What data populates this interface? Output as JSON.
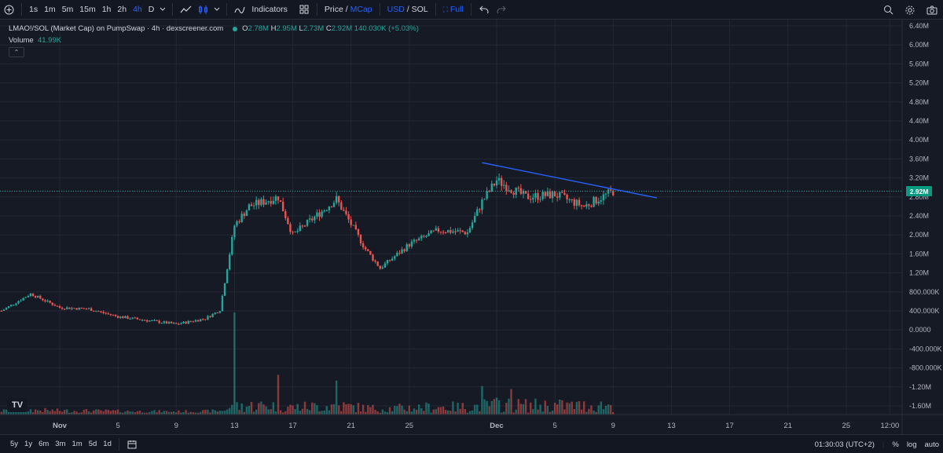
{
  "toolbar": {
    "add_symbol_icon": "plus-circle-icon",
    "intervals": [
      "1s",
      "1m",
      "5m",
      "15m",
      "1h",
      "2h",
      "4h",
      "D"
    ],
    "active_interval": "4h",
    "indicators_label": "Indicators",
    "price_label": "Price",
    "mcap_label": "MCap",
    "usd_label": "USD",
    "sol_label": "SOL",
    "full_label": "Full",
    "slash": "/",
    "accent": "#2962ff"
  },
  "legend": {
    "title": "LMAO!/SOL (Market Cap) on PumpSwap · 4h · dexscreener.com",
    "o_label": "O",
    "o": "2.78M",
    "h_label": "H",
    "h": "2.95M",
    "l_label": "L",
    "l": "2.73M",
    "c_label": "C",
    "c": "2.92M",
    "change": "140.030K (+5.03%)",
    "volume_label": "Volume",
    "volume_value": "41.99K"
  },
  "last_price_tag": "2.92M",
  "colors": {
    "up": "#26a69a",
    "down": "#ef5350",
    "trendline": "#2962ff",
    "background": "#161a25"
  },
  "logo_text": "TV",
  "bottom": {
    "ranges": [
      "5y",
      "1y",
      "6m",
      "3m",
      "1m",
      "5d",
      "1d"
    ],
    "time": "01:30:03 (UTC+2)",
    "percent": "%",
    "log": "log",
    "auto": "auto"
  },
  "chart_data": {
    "type": "candlestick",
    "title": "LMAO!/SOL (Market Cap) on PumpSwap · 4h · dexscreener.com",
    "y_ticks": [
      "6.40M",
      "6.00M",
      "5.60M",
      "5.20M",
      "4.80M",
      "4.40M",
      "4.00M",
      "3.60M",
      "3.20M",
      "2.80M",
      "2.40M",
      "2.00M",
      "1.60M",
      "1.20M",
      "800.000K",
      "400.000K",
      "0.0000",
      "-400.000K",
      "-800.000K",
      "-1.20M",
      "-1.60M"
    ],
    "ylim": [
      -1600000,
      6400000
    ],
    "x_ticks": [
      "Nov",
      "5",
      "9",
      "13",
      "17",
      "21",
      "25",
      "Dec",
      "5",
      "9",
      "13",
      "17",
      "21",
      "25",
      "12:00"
    ],
    "x_dates": [
      "2024-11-01",
      "2024-11-05",
      "2024-11-09",
      "2024-11-13",
      "2024-11-17",
      "2024-11-21",
      "2024-11-25",
      "2024-12-01",
      "2024-12-05",
      "2024-12-09",
      "2024-12-13",
      "2024-12-17",
      "2024-12-21",
      "2024-12-25",
      "2024-12-28"
    ],
    "grid": true,
    "last_price": 2920000,
    "price_series": [
      {
        "date": "2024-10-28",
        "close": 400000
      },
      {
        "date": "2024-10-30",
        "close": 760000
      },
      {
        "date": "2024-11-01",
        "close": 470000
      },
      {
        "date": "2024-11-03",
        "close": 440000
      },
      {
        "date": "2024-11-05",
        "close": 280000
      },
      {
        "date": "2024-11-07",
        "close": 200000
      },
      {
        "date": "2024-11-09",
        "close": 120000
      },
      {
        "date": "2024-11-11",
        "close": 240000
      },
      {
        "date": "2024-11-12",
        "close": 420000
      },
      {
        "date": "2024-11-13",
        "close": 2200000
      },
      {
        "date": "2024-11-14",
        "close": 2600000
      },
      {
        "date": "2024-11-16",
        "close": 2800000
      },
      {
        "date": "2024-11-17",
        "close": 2000000
      },
      {
        "date": "2024-11-19",
        "close": 2500000
      },
      {
        "date": "2024-11-20",
        "close": 2750000
      },
      {
        "date": "2024-11-22",
        "close": 1700000
      },
      {
        "date": "2024-11-23",
        "close": 1300000
      },
      {
        "date": "2024-11-25",
        "close": 1800000
      },
      {
        "date": "2024-11-27",
        "close": 2100000
      },
      {
        "date": "2024-11-29",
        "close": 2050000
      },
      {
        "date": "2024-11-30",
        "close": 2700000
      },
      {
        "date": "2024-12-01",
        "close": 3150000
      },
      {
        "date": "2024-12-03",
        "close": 2800000
      },
      {
        "date": "2024-12-05",
        "close": 2850000
      },
      {
        "date": "2024-12-07",
        "close": 2600000
      },
      {
        "date": "2024-12-09",
        "close": 2920000
      }
    ],
    "volume_series": [
      {
        "date": "2024-11-13",
        "volume": 1800000
      },
      {
        "date": "2024-11-16",
        "volume": 700000
      },
      {
        "date": "2024-11-20",
        "volume": 600000
      },
      {
        "date": "2024-11-30",
        "volume": 500000
      },
      {
        "date": "2024-12-02",
        "volume": 450000
      },
      {
        "date": "2024-12-09",
        "volume": 42000
      }
    ],
    "trendline": {
      "from": {
        "date": "2024-11-30",
        "value": 3520000
      },
      "to": {
        "date": "2024-12-12",
        "value": 2780000
      }
    }
  }
}
